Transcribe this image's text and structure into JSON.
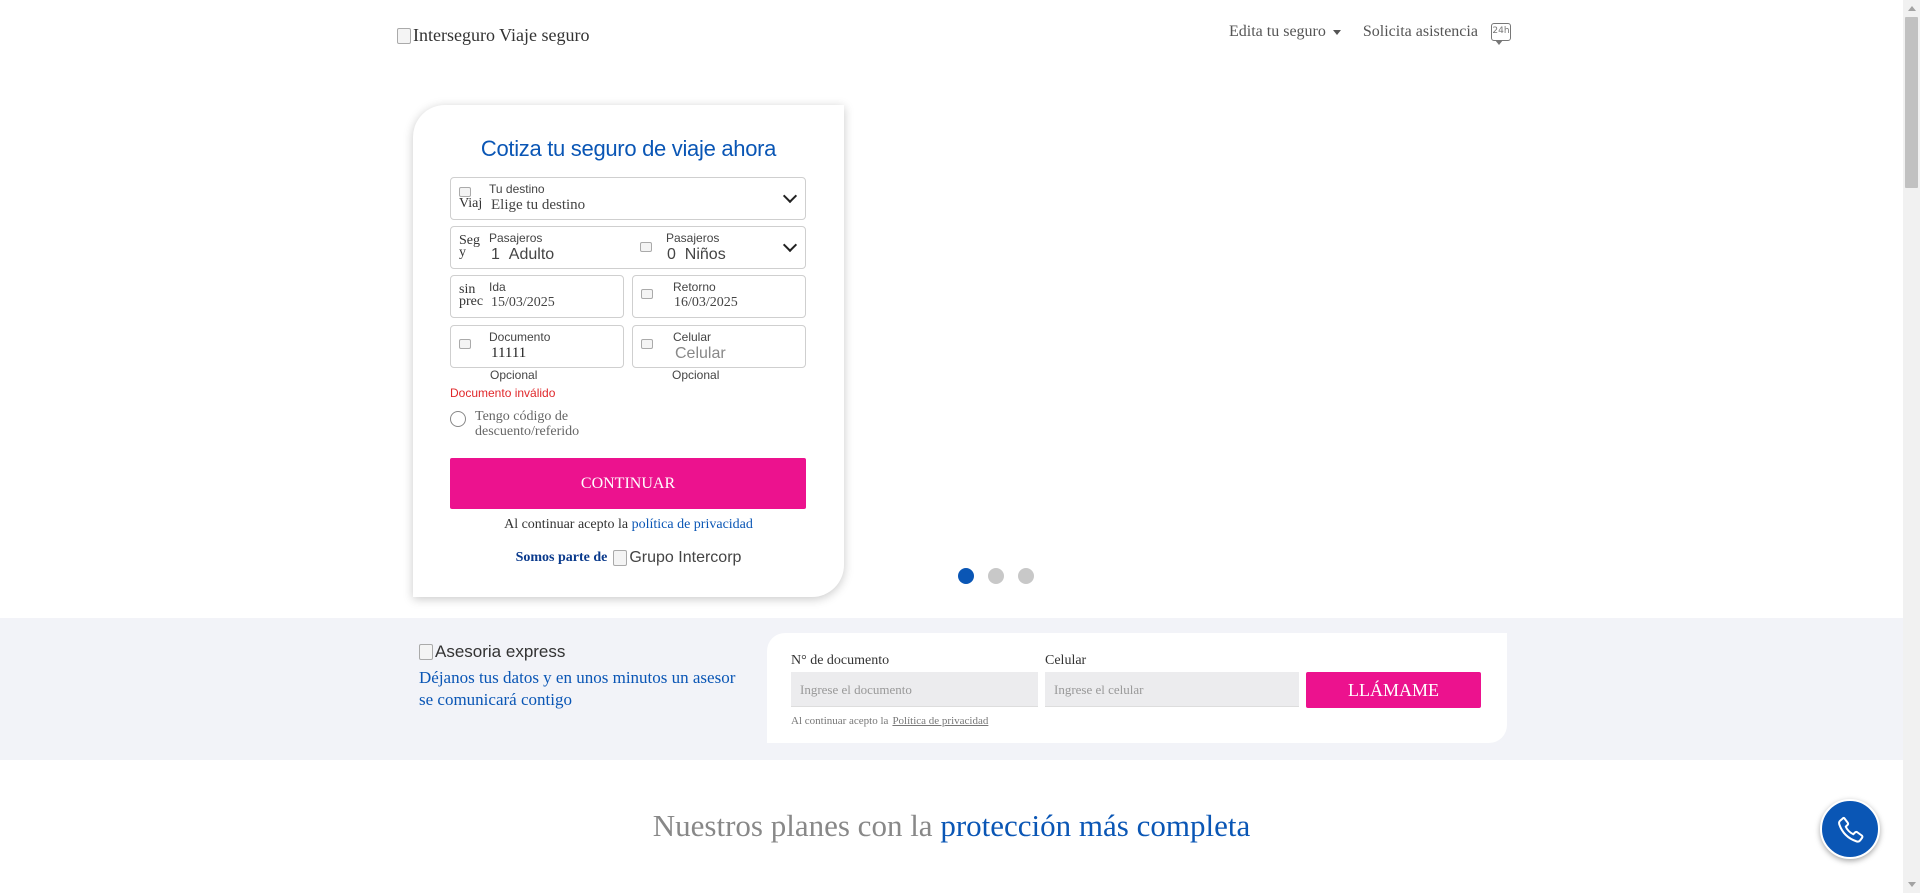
{
  "header": {
    "logo_alt": "Interseguro Viaje seguro",
    "nav": {
      "edit_insurance": "Edita tu seguro",
      "request_assistance": "Solicita asistencia"
    }
  },
  "quote_form": {
    "title": "Cotiza tu seguro de viaje ahora",
    "destination": {
      "icon_alt": "Viaj",
      "label": "Tu destino",
      "value": "Elige tu destino"
    },
    "adults": {
      "icon_alt": "Seg y",
      "label": "Pasajeros",
      "count": "1",
      "unit": "Adulto"
    },
    "children": {
      "icon_alt": "Seg",
      "label": "Pasajeros",
      "count": "0",
      "unit": "Niños"
    },
    "departure": {
      "icon_alt": "sin prec",
      "label": "Ida",
      "value": "15/03/2025"
    },
    "return": {
      "label": "Retorno",
      "value": "16/03/2025"
    },
    "document": {
      "label": "Documento",
      "value": "11111",
      "hint": "Opcional"
    },
    "phone": {
      "label": "Celular",
      "placeholder": "Celular",
      "hint": "Opcional"
    },
    "error_text": "Documento inválido",
    "discount_radio_label": "Tengo código de descuento/referido",
    "continue_label": "CONTINUAR",
    "privacy_prefix": "Al continuar acepto la",
    "privacy_link": "política de privacidad",
    "part_of_label": "Somos parte de",
    "group_logo_alt": "Grupo Intercorp"
  },
  "carousel": {
    "slides": 3,
    "active_index": 0
  },
  "express": {
    "logo_alt": "Asesoria express",
    "text": "Déjanos tus datos y en unos minutos un asesor se comunicará contigo",
    "doc_label": "N° de documento",
    "doc_placeholder": "Ingrese el documento",
    "phone_label": "Celular",
    "phone_placeholder": "Ingrese el celular",
    "button_label": "LLÁMAME",
    "privacy_prefix": "Al continuar acepto la",
    "privacy_link": "Política de privacidad"
  },
  "plans_section": {
    "title_prefix": "Nuestros planes con la",
    "title_highlight": "protección más completa"
  },
  "colors": {
    "brand_blue": "#0a56b5",
    "brand_pink": "#ec128e",
    "error_red": "#e0282b",
    "band_bg": "#f2f3f8"
  }
}
